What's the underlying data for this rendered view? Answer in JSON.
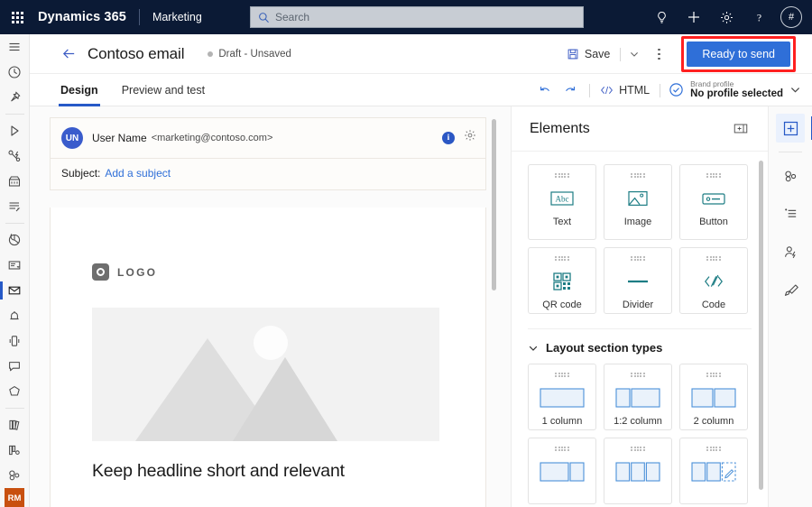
{
  "topnav": {
    "waffle_label": "app-launcher",
    "brand": "Dynamics 365",
    "app_name": "Marketing",
    "search_placeholder": "Search",
    "search_value": "",
    "icons": [
      "lightbulb-icon",
      "plus-icon",
      "gear-icon",
      "help-icon"
    ],
    "avatar_initials": "#",
    "bg_color": "#0b1a35"
  },
  "rail": {
    "items": [
      {
        "name": "site-map-icon",
        "label": "Site map"
      },
      {
        "name": "recent-icon",
        "label": "Recent"
      },
      {
        "name": "pinned-icon",
        "label": "Pinned"
      },
      {
        "name": "journeys-icon",
        "label": "Journeys"
      },
      {
        "name": "triggers-icon",
        "label": "Triggers"
      },
      {
        "name": "events-icon",
        "label": "Events"
      },
      {
        "name": "forms-icon",
        "label": "Forms"
      },
      {
        "name": "analytics-icon",
        "label": "Analytics"
      },
      {
        "name": "pages-icon",
        "label": "Pages"
      },
      {
        "name": "emails-icon",
        "label": "Emails"
      },
      {
        "name": "push-icon",
        "label": "Push notifications"
      },
      {
        "name": "mobile-icon",
        "label": "Mobile"
      },
      {
        "name": "text-message-icon",
        "label": "Text messages"
      },
      {
        "name": "custom-channel-icon",
        "label": "Custom channels"
      },
      {
        "name": "library-icon",
        "label": "Library"
      },
      {
        "name": "assets-icon",
        "label": "Assets"
      },
      {
        "name": "segments-icon",
        "label": "Segments"
      }
    ],
    "selected_index": 9,
    "badge": "RM",
    "badge_color": "#c8500f"
  },
  "cmdbar": {
    "back_label": "back-arrow",
    "title": "Contoso email",
    "status": "Draft - Unsaved",
    "save_label": "Save",
    "save_dropdown": "chevron-down-icon",
    "more_label": "More commands",
    "primary_button": "Ready to send",
    "primary_color": "#2f6fd8",
    "highlight_color": "#ff2020"
  },
  "tabs": {
    "items": [
      {
        "label": "Design",
        "active": true
      },
      {
        "label": "Preview and test",
        "active": false
      }
    ],
    "undo_label": "undo-icon",
    "redo_label": "redo-icon",
    "html_label": "HTML",
    "brand_profile_label": "Brand profile",
    "brand_profile_value": "No profile selected"
  },
  "email": {
    "avatar_initials": "UN",
    "sender_name": "User Name",
    "sender_address": "<marketing@contoso.com>",
    "info_icon": "info-icon",
    "settings_icon": "gear-icon",
    "subject_label": "Subject:",
    "subject_placeholder": "Add a subject",
    "logo_text": "LOGO",
    "headline": "Keep headline short and relevant"
  },
  "panel": {
    "title": "Elements",
    "expand_icon": "expand-panel-icon",
    "elements": [
      {
        "label": "Text",
        "icon": "text-abc-icon"
      },
      {
        "label": "Image",
        "icon": "image-icon"
      },
      {
        "label": "Button",
        "icon": "button-icon"
      },
      {
        "label": "QR code",
        "icon": "qr-code-icon"
      },
      {
        "label": "Divider",
        "icon": "divider-icon"
      },
      {
        "label": "Code",
        "icon": "code-icon"
      }
    ],
    "section_layout_title": "Layout section types",
    "section_collapse_icon": "chevron-down-icon",
    "layouts_row1": [
      {
        "label": "1 column",
        "cols": [
          1
        ]
      },
      {
        "label": "1:2 column",
        "cols": [
          1,
          2
        ]
      },
      {
        "label": "2 column",
        "cols": [
          1,
          1
        ]
      }
    ],
    "layouts_row2": [
      {
        "label": "",
        "cols": [
          2,
          1
        ]
      },
      {
        "label": "",
        "cols": [
          1,
          1,
          1
        ]
      },
      {
        "label": "",
        "cols": [
          1,
          1,
          1
        ]
      }
    ],
    "accent_color": "#1d7d84"
  },
  "toolrail": {
    "items": [
      {
        "name": "add-element-icon",
        "selected": true
      },
      {
        "name": "segments-icon",
        "selected": false
      },
      {
        "name": "content-list-icon",
        "selected": false
      },
      {
        "name": "personalization-icon",
        "selected": false
      },
      {
        "name": "styles-brush-icon",
        "selected": false
      }
    ]
  }
}
